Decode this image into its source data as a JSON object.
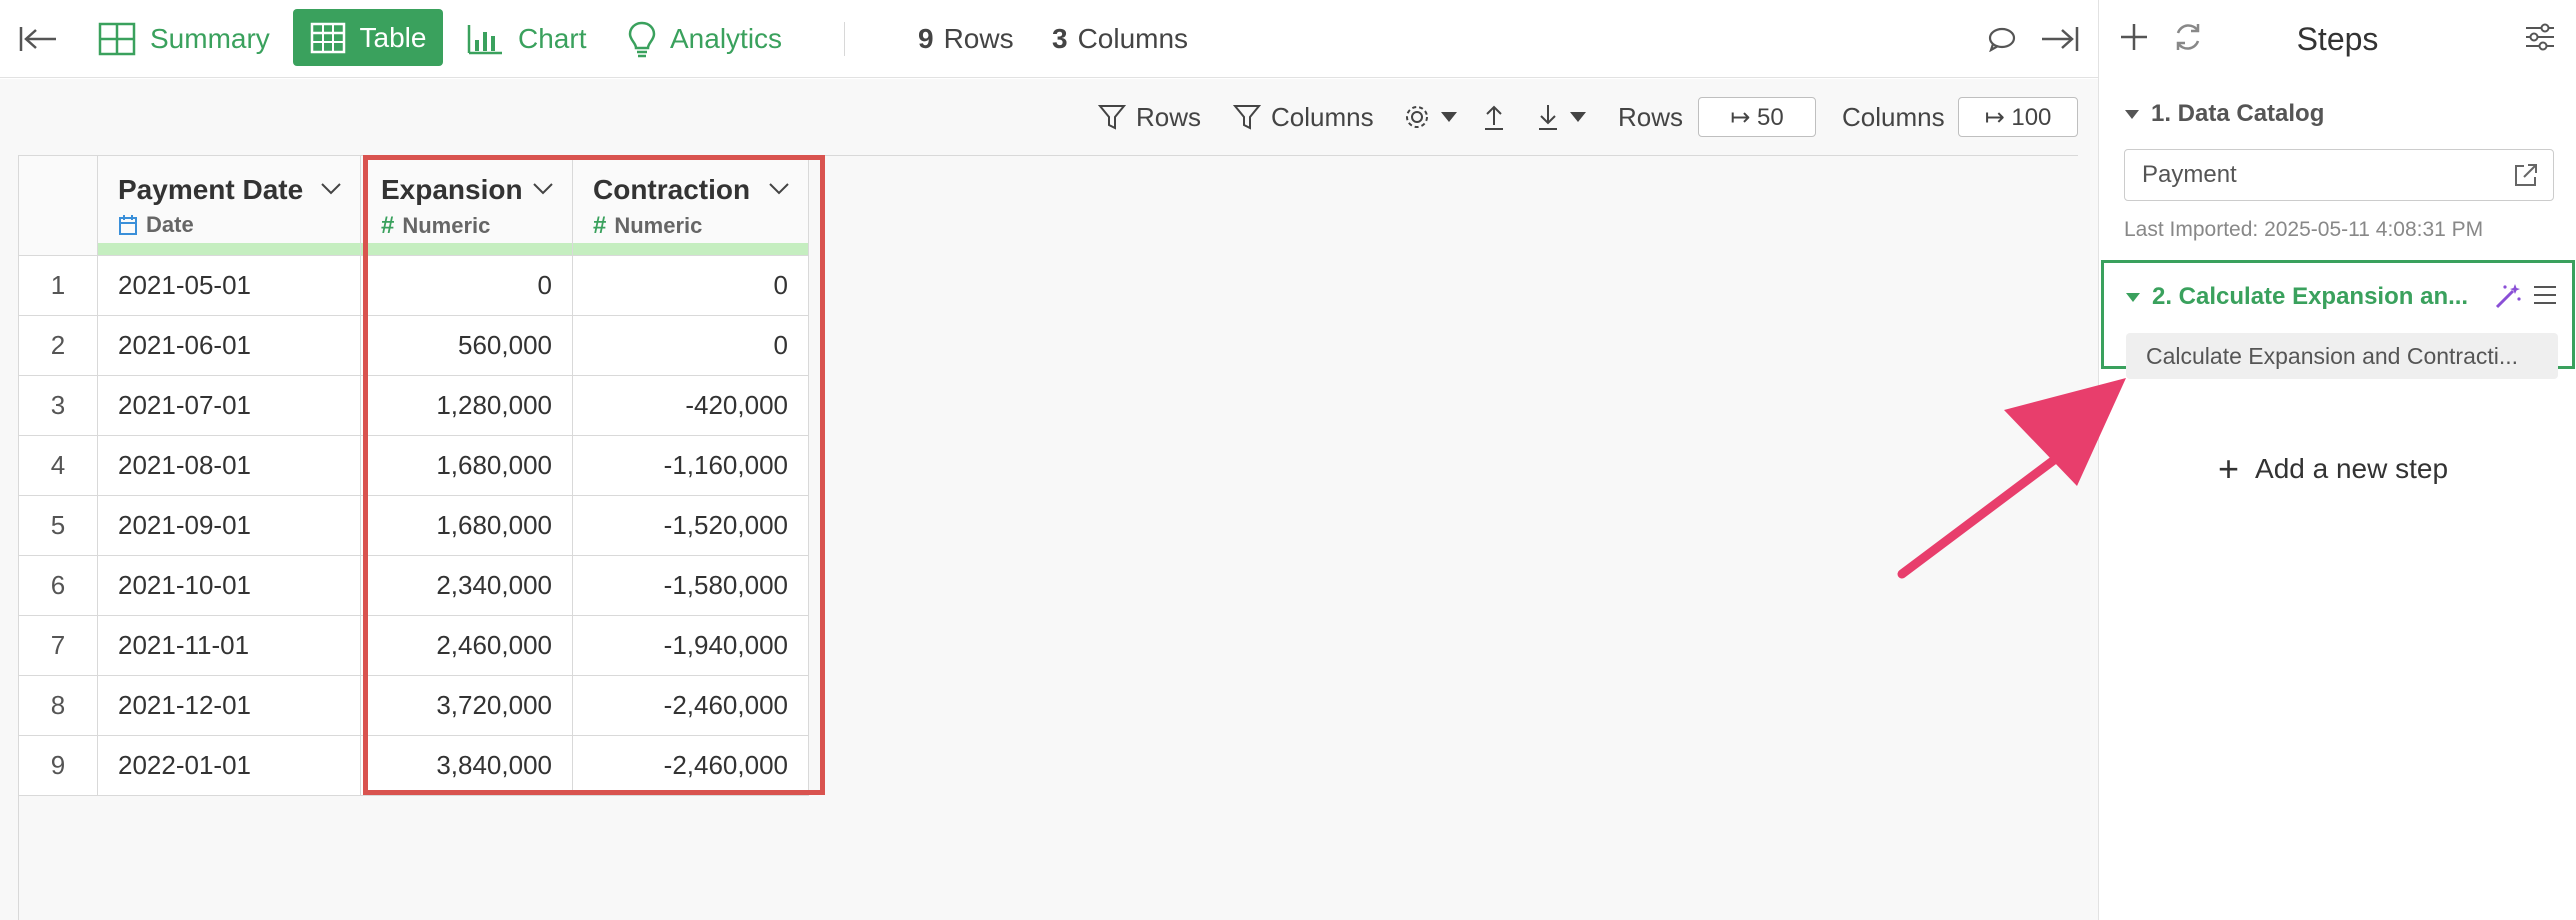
{
  "topbar": {
    "tabs": [
      {
        "label": "Summary",
        "icon": "summary-grid-icon"
      },
      {
        "label": "Table",
        "icon": "table-icon",
        "active": true
      },
      {
        "label": "Chart",
        "icon": "bar-chart-icon"
      },
      {
        "label": "Analytics",
        "icon": "lightbulb-icon"
      }
    ],
    "rows_count": "9",
    "rows_label": "Rows",
    "cols_count": "3",
    "cols_label": "Columns"
  },
  "toolbar": {
    "rows_filter": "Rows",
    "columns_filter": "Columns",
    "rows_label": "Rows",
    "rows_value": "↦ 50",
    "columns_label": "Columns",
    "columns_value": "↦ 100"
  },
  "table": {
    "columns": [
      {
        "name": "Payment Date",
        "type": "Date"
      },
      {
        "name": "Expansion",
        "type": "Numeric"
      },
      {
        "name": "Contraction",
        "type": "Numeric"
      }
    ],
    "rows": [
      [
        "1",
        "2021-05-01",
        "0",
        "0"
      ],
      [
        "2",
        "2021-06-01",
        "560,000",
        "0"
      ],
      [
        "3",
        "2021-07-01",
        "1,280,000",
        "-420,000"
      ],
      [
        "4",
        "2021-08-01",
        "1,680,000",
        "-1,160,000"
      ],
      [
        "5",
        "2021-09-01",
        "1,680,000",
        "-1,520,000"
      ],
      [
        "6",
        "2021-10-01",
        "2,340,000",
        "-1,580,000"
      ],
      [
        "7",
        "2021-11-01",
        "2,460,000",
        "-1,940,000"
      ],
      [
        "8",
        "2021-12-01",
        "3,720,000",
        "-2,460,000"
      ],
      [
        "9",
        "2022-01-01",
        "3,840,000",
        "-2,460,000"
      ]
    ]
  },
  "steps_panel": {
    "title": "Steps",
    "step1": {
      "title": "1. Data Catalog",
      "source": "Payment",
      "imported": "Last Imported: 2025-05-11 4:08:31 PM"
    },
    "step2": {
      "title": "2. Calculate Expansion an...",
      "description": "Calculate Expansion and Contracti..."
    },
    "add_step": "Add a new step"
  },
  "colors": {
    "accent": "#3aa15d",
    "highlight": "#d9534f",
    "arrow": "#e83e6c"
  }
}
